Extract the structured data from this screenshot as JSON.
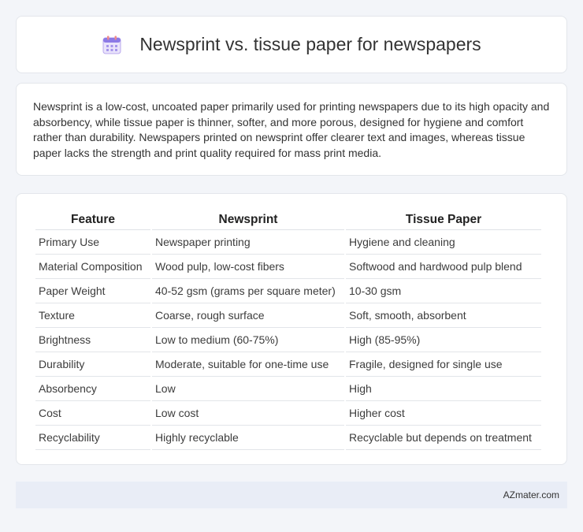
{
  "header": {
    "title": "Newsprint vs. tissue paper for newspapers",
    "icon": "calendar-icon"
  },
  "intro": {
    "text": "Newsprint is a low-cost, uncoated paper primarily used for printing newspapers due to its high opacity and absorbency, while tissue paper is thinner, softer, and more porous, designed for hygiene and comfort rather than durability. Newspapers printed on newsprint offer clearer text and images, whereas tissue paper lacks the strength and print quality required for mass print media."
  },
  "table": {
    "headers": [
      "Feature",
      "Newsprint",
      "Tissue Paper"
    ],
    "rows": [
      [
        "Primary Use",
        "Newspaper printing",
        "Hygiene and cleaning"
      ],
      [
        "Material Composition",
        "Wood pulp, low-cost fibers",
        "Softwood and hardwood pulp blend"
      ],
      [
        "Paper Weight",
        "40-52 gsm (grams per square meter)",
        "10-30 gsm"
      ],
      [
        "Texture",
        "Coarse, rough surface",
        "Soft, smooth, absorbent"
      ],
      [
        "Brightness",
        "Low to medium (60-75%)",
        "High (85-95%)"
      ],
      [
        "Durability",
        "Moderate, suitable for one-time use",
        "Fragile, designed for single use"
      ],
      [
        "Absorbency",
        "Low",
        "High"
      ],
      [
        "Cost",
        "Low cost",
        "Higher cost"
      ],
      [
        "Recyclability",
        "Highly recyclable",
        "Recyclable but depends on treatment"
      ]
    ]
  },
  "footer": {
    "text": "AZmater.com"
  }
}
